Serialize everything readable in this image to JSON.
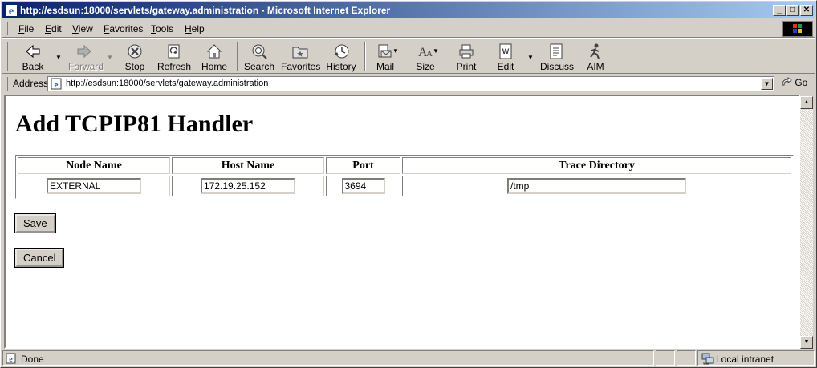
{
  "window": {
    "title": "http://esdsun:18000/servlets/gateway.administration - Microsoft Internet Explorer",
    "controls": {
      "minimize": "_",
      "maximize": "□",
      "close": "✕"
    }
  },
  "menu": {
    "items": [
      {
        "accel": "F",
        "rest": "ile"
      },
      {
        "accel": "E",
        "rest": "dit"
      },
      {
        "accel": "V",
        "rest": "iew"
      },
      {
        "accel": "F",
        "rest": "avorites",
        "full": "Favorites"
      },
      {
        "accel": "T",
        "rest": "ools"
      },
      {
        "accel": "H",
        "rest": "elp"
      }
    ]
  },
  "toolbar": {
    "back": "Back",
    "forward": "Forward",
    "stop": "Stop",
    "refresh": "Refresh",
    "home": "Home",
    "search": "Search",
    "favorites": "Favorites",
    "history": "History",
    "mail": "Mail",
    "size": "Size",
    "print": "Print",
    "edit": "Edit",
    "discuss": "Discuss",
    "aim": "AIM"
  },
  "address": {
    "label": "Address",
    "url": "http://esdsun:18000/servlets/gateway.administration",
    "go": "Go"
  },
  "page": {
    "title": "Add TCPIP81 Handler",
    "table": {
      "headers": [
        "Node Name",
        "Host Name",
        "Port",
        "Trace Directory"
      ],
      "values": {
        "node_name": "EXTERNAL",
        "host_name": "172.19.25.152",
        "port": "3694",
        "trace_directory": "/tmp"
      }
    },
    "save_label": "Save",
    "cancel_label": "Cancel"
  },
  "status": {
    "text": "Done",
    "zone": "Local intranet"
  }
}
